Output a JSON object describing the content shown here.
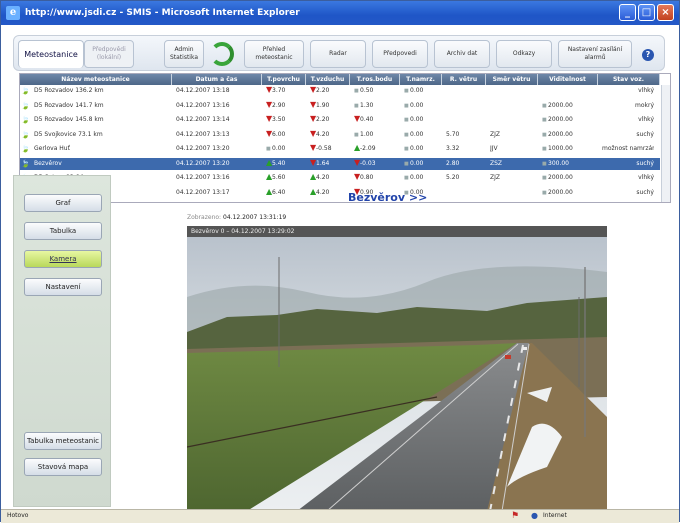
{
  "window": {
    "title": "http://www.jsdi.cz - SMIS - Microsoft Internet Explorer",
    "minimize": "_",
    "maximize": "□",
    "close": "×"
  },
  "tabs": [
    {
      "label": "Meteostanice"
    },
    {
      "label": "Předpovědi (lokální)"
    }
  ],
  "toolbar": {
    "admin": "Admin Statistika",
    "prehled": "Přehled meteostanic",
    "radar": "Radar",
    "predpovedi": "Předpovedi",
    "archiv": "Archiv dat",
    "odkazy": "Odkazy",
    "nastaveni": "Nastavení zasílání alarmů",
    "help": "?"
  },
  "table": {
    "columns": [
      "Název meteostanice",
      "Datum a čas",
      "T.povrchu",
      "T.vzduchu",
      "T.ros.bodu",
      "T.namrz.",
      "R. větru",
      "Směr větru",
      "Viditelnost",
      "Stav voz."
    ],
    "rows": [
      {
        "name": "D5 Rozvadov 136.2 km",
        "time": "04.12.2007 13:18",
        "tp": "3.70",
        "tpd": "dn",
        "tv": "2.20",
        "tvd": "dn",
        "tr": "0.50",
        "trd": "sq",
        "tn": "0.00",
        "rv": "",
        "sv": "",
        "vis": "",
        "stav": "vlhký"
      },
      {
        "name": "D5 Rozvadov 141.7 km",
        "time": "04.12.2007 13:16",
        "tp": "2.90",
        "tpd": "dn",
        "tv": "1.90",
        "tvd": "dn",
        "tr": "1.30",
        "trd": "sq",
        "tn": "0.00",
        "rv": "",
        "sv": "",
        "vis": "2000.00",
        "stav": "mokrý"
      },
      {
        "name": "D5 Rozvadov 145.8 km",
        "time": "04.12.2007 13:14",
        "tp": "3.50",
        "tpd": "dn",
        "tv": "2.20",
        "tvd": "dn",
        "tr": "0.40",
        "trd": "dn",
        "tn": "0.00",
        "rv": "",
        "sv": "",
        "vis": "2000.00",
        "stav": "vlhký"
      },
      {
        "name": "D5 Svojkovice 73.1 km",
        "time": "04.12.2007 13:13",
        "tp": "6.00",
        "tpd": "dn",
        "tv": "4.20",
        "tvd": "dn",
        "tr": "1.00",
        "trd": "sq",
        "tn": "0.00",
        "rv": "5.70",
        "sv": "ZJZ",
        "vis": "2000.00",
        "stav": "suchý"
      },
      {
        "name": "Gerlova Huť",
        "time": "04.12.2007 13:20",
        "tp": "0.00",
        "tpd": "sq",
        "tv": "-0.58",
        "tvd": "dn",
        "tr": "-2.09",
        "trd": "up",
        "tn": "0.00",
        "rv": "3.32",
        "sv": "JJV",
        "vis": "1000.00",
        "stav": "možnost namrzání"
      },
      {
        "name": "Bezvěrov",
        "time": "04.12.2007 13:20",
        "tp": "5.40",
        "tpd": "up",
        "tv": "1.64",
        "tvd": "dn",
        "tr": "-0.03",
        "trd": "dn",
        "tn": "0.00",
        "rv": "2.80",
        "sv": "ZSZ",
        "vis": "300.00",
        "stav": "suchý"
      },
      {
        "name": "D5 Ostrov 83.6 km",
        "time": "04.12.2007 13:16",
        "tp": "5.60",
        "tpd": "up",
        "tv": "4.20",
        "tvd": "up",
        "tr": "0.80",
        "trd": "dn",
        "tn": "0.00",
        "rv": "5.20",
        "sv": "ZJZ",
        "vis": "2000.00",
        "stav": "vlhký"
      },
      {
        "name": "D5 Ostrov 84.5 km",
        "time": "04.12.2007 13:17",
        "tp": "6.40",
        "tpd": "up",
        "tv": "4.20",
        "tvd": "up",
        "tr": "0.90",
        "trd": "dn",
        "tn": "0.00",
        "rv": "",
        "sv": "",
        "vis": "2000.00",
        "stav": "suchý"
      }
    ]
  },
  "sidebar": {
    "graf": "Graf",
    "tabulka": "Tabulka",
    "kamera": "Kamera",
    "nastaveni": "Nastavení",
    "tabulka_meteostanic": "Tabulka meteostanic",
    "stavova_mapa": "Stavová mapa"
  },
  "station": {
    "title": "Bezvěrov >>",
    "timestamp_label": "Zobrazeno:",
    "timestamp_value": "04.12.2007 13:31:19",
    "camera_caption": "Bezvěrov 0 – 04.12.2007 13:29:02"
  },
  "status": {
    "left": "Hotovo",
    "zone": "Internet"
  }
}
